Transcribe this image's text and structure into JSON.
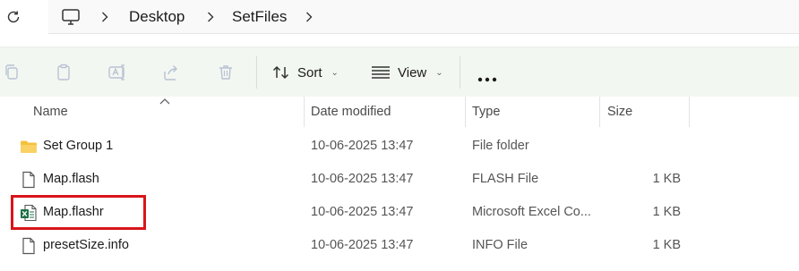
{
  "address_bar": {
    "refresh_icon": "refresh-icon",
    "pc_icon": "computer-icon",
    "breadcrumb": [
      "Desktop",
      "SetFiles"
    ]
  },
  "command_bar": {
    "icons": [
      "copy-icon",
      "paste-icon",
      "rename-icon",
      "share-icon",
      "delete-icon"
    ],
    "sort_label": "Sort",
    "view_label": "View",
    "more_icon": "more-icon"
  },
  "columns": {
    "name": "Name",
    "date": "Date modified",
    "type": "Type",
    "size": "Size"
  },
  "files": [
    {
      "name": "Set Group 1",
      "date": "10-06-2025 13:47",
      "type": "File folder",
      "size": "",
      "icon": "folder-icon"
    },
    {
      "name": "Map.flash",
      "date": "10-06-2025 13:47",
      "type": "FLASH File",
      "size": "1 KB",
      "icon": "file-icon"
    },
    {
      "name": "Map.flashr",
      "date": "10-06-2025 13:47",
      "type": "Microsoft Excel Co...",
      "size": "1 KB",
      "icon": "excel-icon"
    },
    {
      "name": "presetSize.info",
      "date": "10-06-2025 13:47",
      "type": "INFO File",
      "size": "1 KB",
      "icon": "file-icon"
    }
  ],
  "colors": {
    "accent_highlight": "#d9141b",
    "command_bar_bg": "#f3f7f1",
    "folder": "#f4c13d",
    "excel": "#1d7044"
  }
}
